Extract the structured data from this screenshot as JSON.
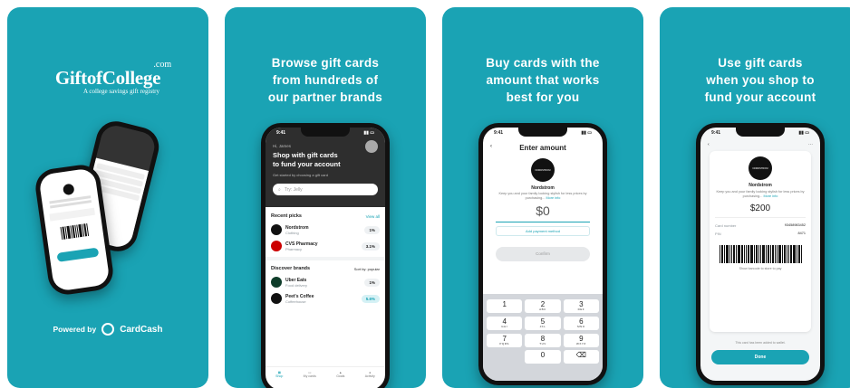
{
  "panel1": {
    "logo_main": "GiftofCollege",
    "logo_com": ".com",
    "logo_tagline": "A college savings gift registry",
    "powered_by": "Powered by",
    "powered_brand": "CardCash"
  },
  "panel2": {
    "caption": [
      "Browse gift cards",
      "from hundreds of",
      "our partner brands"
    ],
    "time": "9:41",
    "greeting": "Hi, James",
    "headline": [
      "Shop with gift cards",
      "to fund your account"
    ],
    "subline": "Get started by choosing a gift card",
    "search_placeholder": "Try: Jelly",
    "recent_title": "Recent picks",
    "view_all": "View all",
    "recent": [
      {
        "name": "Nordstrom",
        "cat": "Clothing",
        "pct": "1%"
      },
      {
        "name": "CVS Pharmacy",
        "cat": "Pharmacy",
        "pct": "3.1%"
      }
    ],
    "discover_title": "Discover brands",
    "sort_label": "Sort by: popular",
    "discover": [
      {
        "name": "Uber Eats",
        "cat": "Food delivery",
        "pct": "1%"
      },
      {
        "name": "Peet's Coffee",
        "cat": "Coffeehouse",
        "pct": "5.6%"
      }
    ],
    "nav": [
      "Shop",
      "My cards",
      "Goals",
      "Activity"
    ]
  },
  "panel3": {
    "caption": [
      "Buy cards with the",
      "amount that works",
      "best for you"
    ],
    "time": "9:41",
    "title": "Enter amount",
    "brand_badge": "NORDSTROM",
    "brand": "Nordstrom",
    "desc": "Keep you and your family looking stylish for less prices by purchasing...",
    "more_info": "More info",
    "amount": "$0",
    "add_payment": "Add payment method",
    "confirm": "Confirm",
    "keys": [
      {
        "n": "1",
        "l": ""
      },
      {
        "n": "2",
        "l": "ABC"
      },
      {
        "n": "3",
        "l": "DEF"
      },
      {
        "n": "4",
        "l": "GHI"
      },
      {
        "n": "5",
        "l": "JKL"
      },
      {
        "n": "6",
        "l": "MNO"
      },
      {
        "n": "7",
        "l": "PQRS"
      },
      {
        "n": "8",
        "l": "TUV"
      },
      {
        "n": "9",
        "l": "WXYZ"
      },
      {
        "n": "",
        "l": ""
      },
      {
        "n": "0",
        "l": ""
      },
      {
        "n": "⌫",
        "l": ""
      }
    ]
  },
  "panel4": {
    "caption": [
      "Use gift cards",
      "when you shop to",
      "fund your account"
    ],
    "time": "9:41",
    "brand_badge": "NORDSTROM",
    "brand": "Nordstrom",
    "desc": "Keep you and your family looking stylish for less prices by purchasing...",
    "more_info": "More info",
    "amount": "$200",
    "card_number_label": "Card number",
    "card_number": "93458983452",
    "pin_label": "PIN",
    "pin": "8471",
    "barcode_hint": "Show barcode to store to pay",
    "added_note": "This card has been added to wallet.",
    "done": "Done"
  },
  "colors": {
    "teal": "#1aa3b4",
    "dark": "#111111"
  }
}
